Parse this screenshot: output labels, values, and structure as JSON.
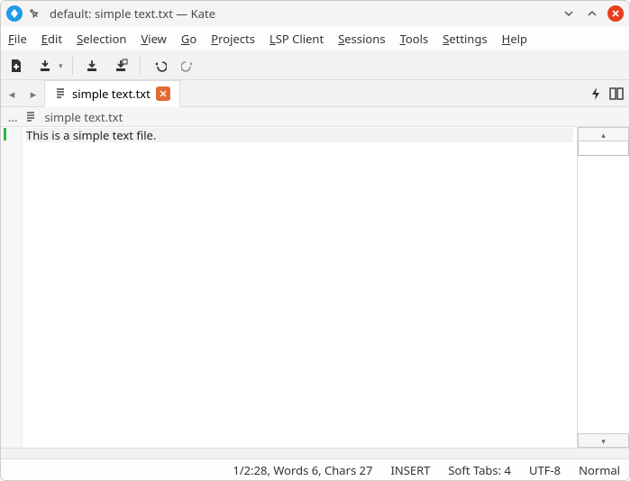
{
  "titlebar": {
    "title": "default: simple text.txt — Kate"
  },
  "menubar": {
    "items": [
      "File",
      "Edit",
      "Selection",
      "View",
      "Go",
      "Projects",
      "LSP Client",
      "Sessions",
      "Tools",
      "Settings",
      "Help"
    ]
  },
  "tab": {
    "label": "simple text.txt"
  },
  "breadcrumb": {
    "ellipsis": "...",
    "file": "simple text.txt"
  },
  "editor": {
    "line1": "This is a simple text file."
  },
  "status": {
    "position": "1/2:28, Words 6, Chars 27",
    "mode": "INSERT",
    "indent": "Soft Tabs: 4",
    "encoding": "UTF-8",
    "vimode": "Normal"
  }
}
